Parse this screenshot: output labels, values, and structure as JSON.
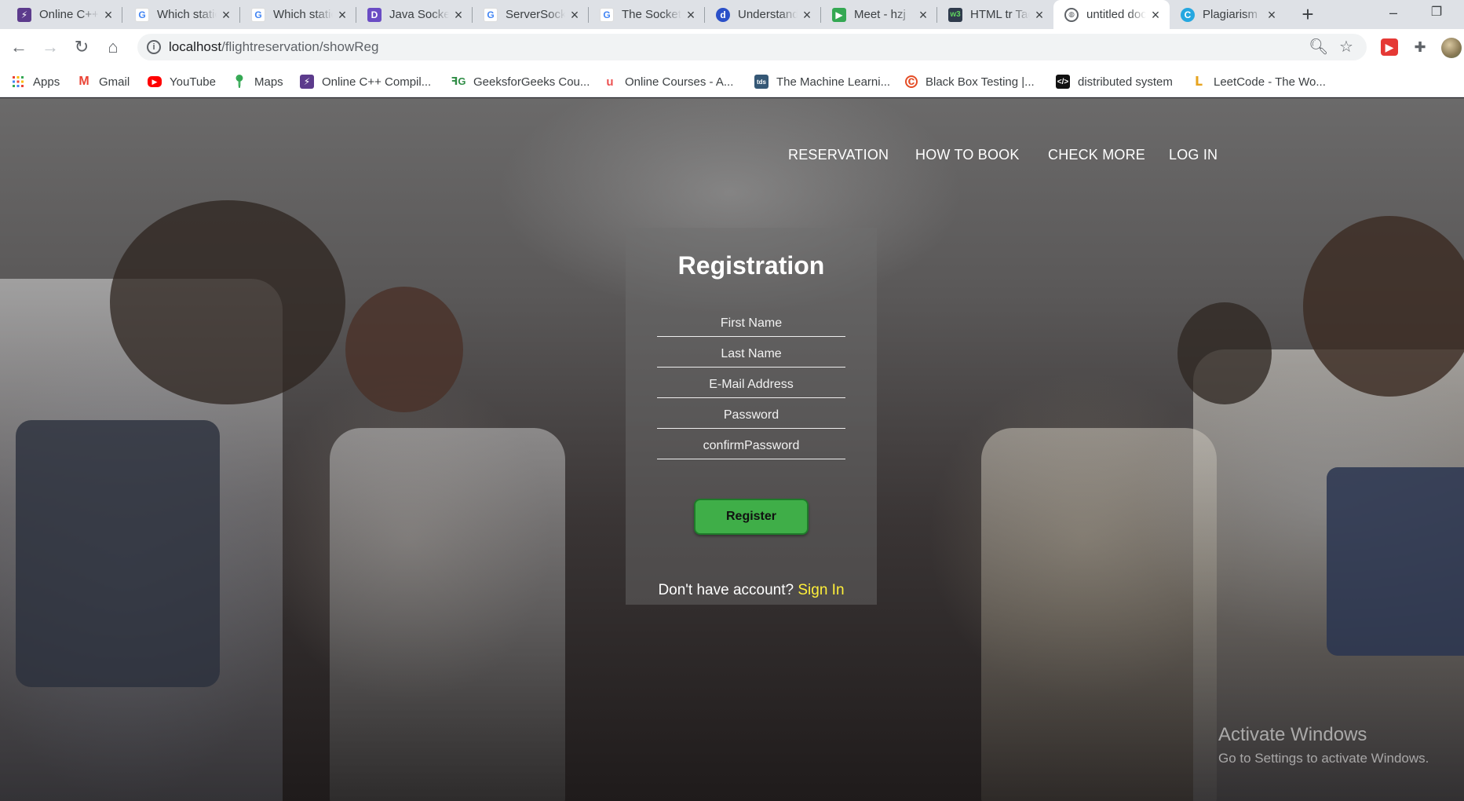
{
  "browser": {
    "tabs": [
      {
        "title": "Online C++ Compiler",
        "favicon": "bolt-icon",
        "color": "#5c3b8c"
      },
      {
        "title": "Which static",
        "favicon": "google-icon",
        "color": "#4285f4"
      },
      {
        "title": "Which static",
        "favicon": "google-icon",
        "color": "#4285f4"
      },
      {
        "title": "Java Socket",
        "favicon": "d-icon",
        "color": "#6a4cc4"
      },
      {
        "title": "ServerSocket",
        "favicon": "google-icon",
        "color": "#4285f4"
      },
      {
        "title": "The Socket",
        "favicon": "google-icon",
        "color": "#4285f4"
      },
      {
        "title": "Understanding",
        "favicon": "d-circle-icon",
        "color": "#2b50c8"
      },
      {
        "title": "Meet - hzj",
        "favicon": "meet-icon",
        "color": "#34a853"
      },
      {
        "title": "HTML tr Tag",
        "favicon": "w3-icon",
        "color": "#2f3b4c"
      },
      {
        "title": "untitled document",
        "favicon": "globe-icon",
        "color": "#5f6368",
        "active": true
      },
      {
        "title": "Plagiarism",
        "favicon": "c-icon",
        "color": "#25a7e0"
      }
    ],
    "new_tab": "+",
    "url_host": "localhost",
    "url_path": "/flightreservation/showReg",
    "bookmarks": [
      {
        "label": "Apps",
        "icon": "apps-grid-icon",
        "color": "#ea4335"
      },
      {
        "label": "Gmail",
        "icon": "gmail-icon",
        "color": "#ea4335"
      },
      {
        "label": "YouTube",
        "icon": "youtube-icon",
        "color": "#ff0000"
      },
      {
        "label": "Maps",
        "icon": "maps-pin-icon",
        "color": "#34a853"
      },
      {
        "label": "Online C++ Compil...",
        "icon": "bolt-icon",
        "color": "#5c3b8c"
      },
      {
        "label": "GeeksforGeeks Cou...",
        "icon": "gfg-icon",
        "color": "#2f8d46"
      },
      {
        "label": "Online Courses - A...",
        "icon": "udemy-icon",
        "color": "#ec5252"
      },
      {
        "label": "The Machine Learni...",
        "icon": "tds-icon",
        "color": "#355876"
      },
      {
        "label": "Black Box Testing |...",
        "icon": "guru-icon",
        "color": "#e44d26"
      },
      {
        "label": "distributed system",
        "icon": "code-icon",
        "color": "#111111"
      },
      {
        "label": "LeetCode - The Wo...",
        "icon": "leetcode-icon",
        "color": "#e7a41f"
      }
    ]
  },
  "site": {
    "nav": [
      {
        "label": "RESERVATION"
      },
      {
        "label": "HOW TO BOOK"
      },
      {
        "label": "CHECK MORE"
      },
      {
        "label": "LOG IN"
      }
    ],
    "form": {
      "title": "Registration",
      "fields": [
        {
          "placeholder": "First Name"
        },
        {
          "placeholder": "Last Name"
        },
        {
          "placeholder": "E-Mail Address"
        },
        {
          "placeholder": "Password"
        },
        {
          "placeholder": "confirmPassword"
        }
      ],
      "submit_label": "Register",
      "account_prompt": "Don't have account?",
      "signin_label": "Sign In"
    },
    "accent_color": "#3fae48",
    "link_color": "#ffef3a"
  },
  "watermark": {
    "line1": "Activate Windows",
    "line2": "Go to Settings to activate Windows."
  }
}
